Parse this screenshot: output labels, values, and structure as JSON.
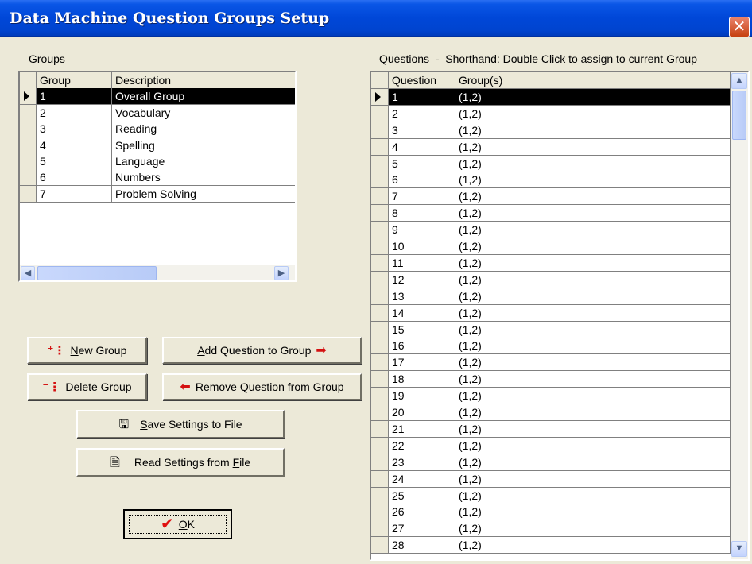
{
  "window": {
    "title": "Data Machine Question Groups Setup"
  },
  "groups_panel": {
    "label": "Groups",
    "headers": [
      "Group",
      "Description"
    ],
    "rows": [
      [
        "1",
        "Overall Group"
      ],
      [
        "2",
        "Vocabulary"
      ],
      [
        "3",
        "Reading"
      ],
      [
        "4",
        "Spelling"
      ],
      [
        "5",
        "Language"
      ],
      [
        "6",
        "Numbers"
      ],
      [
        "7",
        "Problem Solving"
      ]
    ],
    "selected_row": 0
  },
  "questions_panel": {
    "label": "Questions  -  Shorthand: Double Click to assign to current Group",
    "headers": [
      "Question",
      "Group(s)"
    ],
    "rows": [
      [
        "1",
        "(1,2)"
      ],
      [
        "2",
        "(1,2)"
      ],
      [
        "3",
        "(1,2)"
      ],
      [
        "4",
        "(1,2)"
      ],
      [
        "5",
        "(1,2)"
      ],
      [
        "6",
        "(1,2)"
      ],
      [
        "7",
        "(1,2)"
      ],
      [
        "8",
        "(1,2)"
      ],
      [
        "9",
        "(1,2)"
      ],
      [
        "10",
        "(1,2)"
      ],
      [
        "11",
        "(1,2)"
      ],
      [
        "12",
        "(1,2)"
      ],
      [
        "13",
        "(1,2)"
      ],
      [
        "14",
        "(1,2)"
      ],
      [
        "15",
        "(1,2)"
      ],
      [
        "16",
        "(1,2)"
      ],
      [
        "17",
        "(1,2)"
      ],
      [
        "18",
        "(1,2)"
      ],
      [
        "19",
        "(1,2)"
      ],
      [
        "20",
        "(1,2)"
      ],
      [
        "21",
        "(1,2)"
      ],
      [
        "22",
        "(1,2)"
      ],
      [
        "23",
        "(1,2)"
      ],
      [
        "24",
        "(1,2)"
      ],
      [
        "25",
        "(1,2)"
      ],
      [
        "26",
        "(1,2)"
      ],
      [
        "27",
        "(1,2)"
      ],
      [
        "28",
        "(1,2)"
      ]
    ],
    "selected_row": 0
  },
  "buttons": {
    "new_group": {
      "prefix": "",
      "accel": "N",
      "rest": "ew Group",
      "icon": "new-group-icon"
    },
    "delete_group": {
      "prefix": "",
      "accel": "D",
      "rest": "elete Group",
      "icon": "delete-group-icon"
    },
    "add_question": {
      "prefix": "",
      "accel": "A",
      "rest": "dd Question to Group",
      "icon": "right-arrow-icon"
    },
    "remove_question": {
      "prefix": "",
      "accel": "R",
      "rest": "emove Question from Group",
      "icon": "left-arrow-icon"
    },
    "save_settings": {
      "prefix": "",
      "accel": "S",
      "rest": "ave Settings to File",
      "icon": "save-file-icon"
    },
    "read_settings": {
      "prefix": "Read Settings from ",
      "accel": "F",
      "rest": "ile",
      "icon": "read-file-icon"
    },
    "ok": {
      "prefix": "",
      "accel": "O",
      "rest": "K",
      "icon": "check-icon"
    }
  },
  "colors": {
    "title_bar": "#0047d8",
    "selection": "#000000",
    "face": "#ece9d8",
    "arrow_red": "#d41010",
    "check_red": "#e01010"
  }
}
